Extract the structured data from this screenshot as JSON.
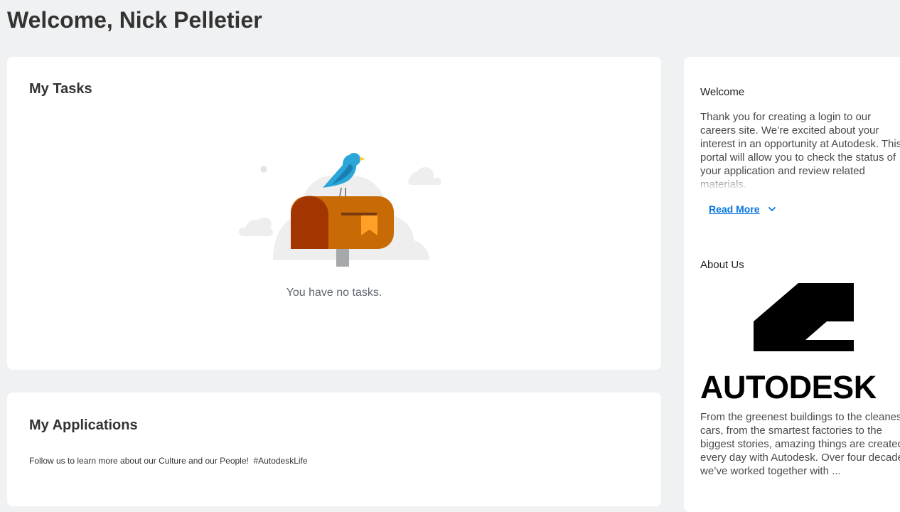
{
  "page": {
    "title": "Welcome, Nick Pelletier"
  },
  "tasks": {
    "heading": "My Tasks",
    "empty_message": "You have no tasks."
  },
  "applications": {
    "heading": "My Applications",
    "note": "Follow us to learn more about our Culture and our People!  #AutodeskLife"
  },
  "sidebar": {
    "welcome": {
      "heading": "Welcome",
      "text": "Thank you for creating a login to our careers site. We’re excited about your interest in an opportunity at Autodesk. This portal will allow you to check the status of your application and review related materials.",
      "read_more_label": "Read More",
      "read_more_icon": "chevron-down-icon"
    },
    "about": {
      "heading": "About Us",
      "logo_text": "AUTODESK",
      "text": "From the greenest buildings to the cleanest cars, from the smartest factories to the biggest stories, amazing things are created every day with Autodesk. Over four decades we’ve worked together with ..."
    }
  },
  "colors": {
    "page_background": "#f0f1f2",
    "card_background": "#ffffff",
    "link": "#0875e1",
    "mailbox_body": "#c86a05",
    "mailbox_door": "#a33600",
    "flag": "#ffa126",
    "bird": "#2aa7d8",
    "cloud": "#eeeeee"
  }
}
